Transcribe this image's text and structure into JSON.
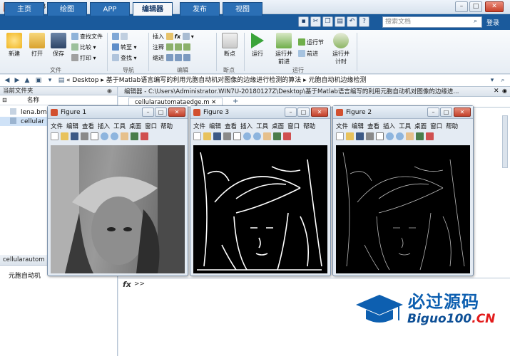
{
  "app": {
    "title": "MATLAB R2018a"
  },
  "ribbon_tabs": [
    "主页",
    "绘图",
    "APP",
    "编辑器",
    "发布",
    "视图"
  ],
  "search": {
    "placeholder": "搜索文档"
  },
  "login": "登录",
  "ribbon": {
    "file": {
      "label": "文件",
      "new": "新建",
      "open": "打开",
      "save": "保存",
      "find_files": "查找文件",
      "compare": "比较",
      "print": "打印"
    },
    "nav": {
      "label": "导航",
      "goto": "转至",
      "find": "查找"
    },
    "edit": {
      "label": "编辑",
      "insert": "插入",
      "comment": "注释",
      "indent": "缩进",
      "fx": "fx"
    },
    "breakpoint": {
      "label": "断点",
      "breakpoints": "断点"
    },
    "run": {
      "label": "运行",
      "run": "运行",
      "run_advance_1": "运行并",
      "run_advance_2": "前进",
      "run_section": "运行节",
      "advance": "前进",
      "run_time_1": "运行并",
      "run_time_2": "计时"
    }
  },
  "address": {
    "path": "« Desktop  ▸  基于Matlab语言编写的利用元胞自动机对图像的边缘进行检测的算法  ▸  元胞自动机边缘检测"
  },
  "current_folder": {
    "header": "当前文件夹",
    "name_col": "名称",
    "files": [
      "lena.bm",
      "cellular"
    ]
  },
  "details": {
    "name": "cellularautom",
    "label": "元胞自动机"
  },
  "editor": {
    "title": "编辑器 - C:\\Users\\Administrator.WIN7U-20180127Z\\Desktop\\基于Matlab语言编写的利用元胞自动机对图像的边缘进...",
    "tab": "cellularautomataedge.m",
    "add": "+"
  },
  "command_window": {
    "prompt": ">>",
    "fx": "fx"
  },
  "figures": [
    {
      "title": "Figure 1"
    },
    {
      "title": "Figure 3"
    },
    {
      "title": "Figure 2"
    }
  ],
  "figure_menu": [
    "文件",
    "编辑",
    "查看",
    "插入",
    "工具",
    "桌面",
    "窗口",
    "帮助"
  ],
  "watermark": {
    "cn": "必过源码",
    "en_main": "Biguo100",
    "en_suffix": ".CN"
  },
  "colors": {
    "ribbon_tab_bar": "#1a5a9c",
    "watermark_blue": "#0d5fb0",
    "watermark_red": "#e21b1b"
  }
}
